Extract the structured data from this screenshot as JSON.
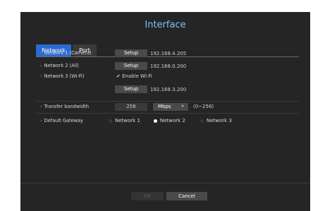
{
  "dialog": {
    "title": "Interface",
    "tabs": [
      {
        "label": "Network",
        "active": true
      },
      {
        "label": "Port",
        "active": false
      }
    ],
    "network1": {
      "label": "Network 1 (Camera)",
      "button": "Setup",
      "ip": "192.168.4.205"
    },
    "network2": {
      "label": "Network 2 (All)",
      "button": "Setup",
      "ip": "192.168.0.200"
    },
    "network3": {
      "label": "Network 3 (Wi-Fi)",
      "wifi_label": "Enable Wi-Fi",
      "wifi_checked": true,
      "button": "Setup",
      "ip": "192.168.3.200"
    },
    "bandwidth": {
      "label": "Transfer bandwidth",
      "value": "256",
      "unit": "Mbps",
      "range": "(0~256)"
    },
    "gateway": {
      "label": "Default Gateway",
      "options": [
        {
          "label": "Network 1",
          "selected": false
        },
        {
          "label": "Network 2",
          "selected": true
        },
        {
          "label": "Network 3",
          "selected": false
        }
      ]
    },
    "footer": {
      "ok": "OK",
      "cancel": "Cancel"
    }
  },
  "colors": {
    "accent": "#2a6bd1",
    "title": "#7fc3f5",
    "panel": "#252525"
  }
}
